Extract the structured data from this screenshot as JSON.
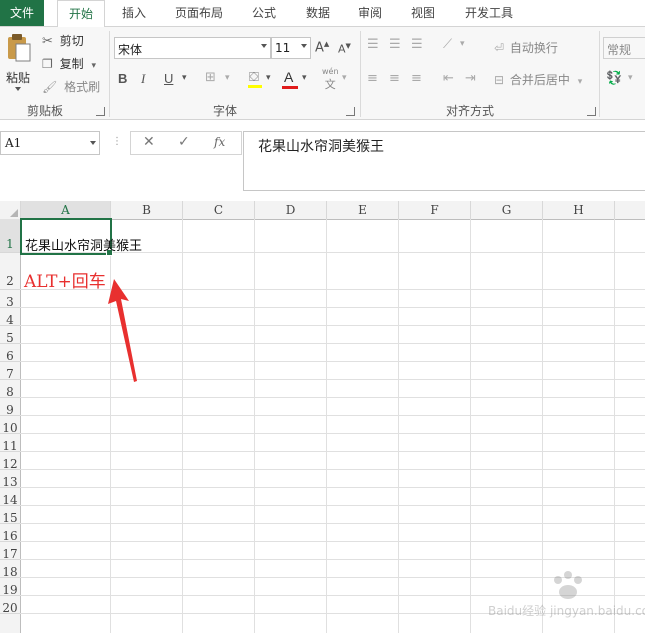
{
  "tabs": [
    "文件",
    "开始",
    "插入",
    "页面布局",
    "公式",
    "数据",
    "审阅",
    "视图",
    "开发工具"
  ],
  "clipboard": {
    "paste": "粘贴",
    "cut": "剪切",
    "copy": "复制",
    "format_painter": "格式刷",
    "group_label": "剪贴板"
  },
  "font": {
    "name": "宋体",
    "size": "11",
    "bold": "B",
    "italic": "I",
    "underline": "U",
    "font_color_letter": "A",
    "group_label": "字体",
    "wen": "wén",
    "font_color": "#e01b1b"
  },
  "alignment": {
    "wrap_text": "自动换行",
    "merge_center": "合并后居中",
    "group_label": "对齐方式"
  },
  "number": {
    "format": "常规"
  },
  "formula_bar": {
    "name_box": "A1",
    "cancel": "✕",
    "enter": "✓",
    "fx": "fx",
    "content": "花果山水帘洞美猴王"
  },
  "grid": {
    "columns": [
      "A",
      "B",
      "C",
      "D",
      "E",
      "F",
      "G",
      "H"
    ],
    "rows": [
      "1",
      "2",
      "3",
      "4",
      "5",
      "6",
      "7",
      "8",
      "9",
      "10",
      "11",
      "12",
      "13",
      "14",
      "15",
      "16",
      "17",
      "18",
      "19",
      "20"
    ],
    "a1": "花果山水帘洞美猴王"
  },
  "annotation": {
    "text": "ALT+回车",
    "color": "#e8302f"
  },
  "watermark": "Baidu经验 jingyan.baidu.com",
  "colors": {
    "accent": "#217346"
  }
}
